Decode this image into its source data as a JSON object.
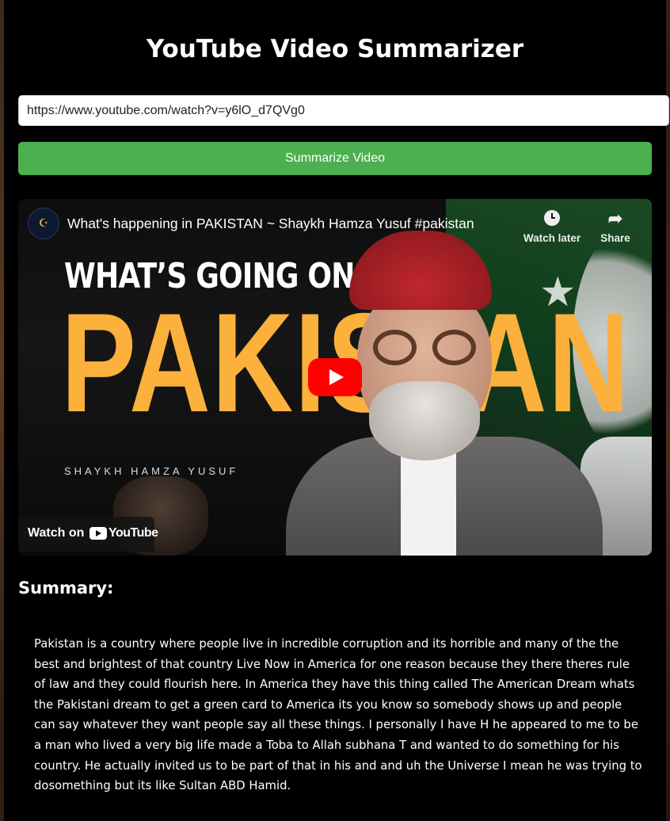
{
  "app": {
    "title": "YouTube Video Summarizer"
  },
  "form": {
    "url_value": "https://www.youtube.com/watch?v=y6lO_d7QVg0",
    "submit_label": "Summarize Video"
  },
  "video": {
    "channel_avatar_text": "☪",
    "title": "What's happening in PAKISTAN ~ Shaykh Hamza Yusuf #pakistan",
    "watch_later_label": "Watch later",
    "share_label": "Share",
    "thumbnail_headline": "WHAT’S GOING ON IN",
    "thumbnail_bigword": "PAKISTAN",
    "thumbnail_author": "SHAYKH HAMZA YUSUF",
    "watch_on_label": "Watch on",
    "youtube_word": "YouTube"
  },
  "summary": {
    "heading": "Summary:",
    "text": "Pakistan is a country where people live in incredible corruption and its horrible and many of the the best and brightest of that country Live Now in America for one reason because they there theres rule of law and they could flourish here. In America they have this thing called The American Dream whats the Pakistani dream to get a green card to America its you know so somebody shows up and people can say whatever they want people say all these things. I personally I have H he appeared to me to be a man who lived a very big life made a Toba to Allah subhana T and wanted to do something for his country. He actually invited us to be part of that in his and and uh the Universe I mean he was trying to dosomething but its like Sultan ABD Hamid."
  },
  "colors": {
    "button_green": "#4caf50",
    "play_red": "#ff0000",
    "thumbnail_yellow": "#fbb13c"
  },
  "icons": {
    "watch_later": "clock-icon",
    "share": "share-arrow-icon",
    "play": "play-icon",
    "youtube": "youtube-logo-icon"
  }
}
